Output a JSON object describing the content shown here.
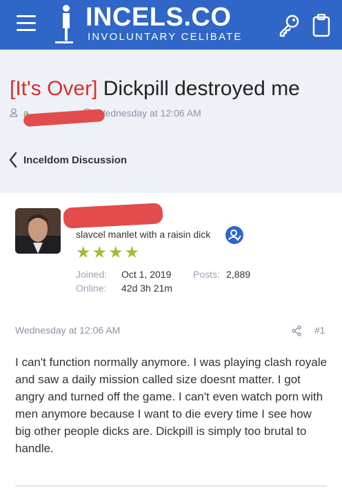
{
  "header": {
    "logo_title": "INCELS.CO",
    "logo_subtitle": "INVOLUNTARY CELIBATE",
    "background": "#2f66c7",
    "icons": [
      "hamburger-menu-icon",
      "key-icon",
      "clipboard-icon"
    ]
  },
  "thread": {
    "prefix": "[It's Over]",
    "title": "Dickpill destroyed me",
    "author_initial": "a",
    "date": "Wednesday at 12:06 AM"
  },
  "breadcrumb": {
    "label": "Inceldom Discussion"
  },
  "post": {
    "user_title": "slavcel manlet with a raisin dick",
    "stars": "★★★★",
    "stats": [
      {
        "key": "Joined:",
        "value": "Oct 1, 2019"
      },
      {
        "key": "Posts:",
        "value": "2,889"
      },
      {
        "key": "Online:",
        "value": "42d 3h 21m"
      }
    ],
    "date": "Wednesday at 12:06 AM",
    "number": "#1",
    "body": "I can't function normally anymore. I was playing clash royale and saw a daily mission called size doesnt matter. I got angry and turned off the game. I can't even watch porn with men anymore because I want to die every time I see how big other people dicks are. Dickpill is simply too brutal to handle."
  },
  "colors": {
    "prefix_red": "#d8302a",
    "accent_blue": "#2f66c7",
    "star_green": "#a9b83a"
  }
}
